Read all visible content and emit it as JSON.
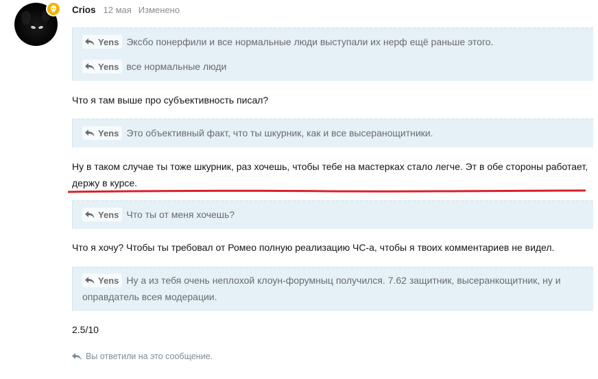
{
  "post": {
    "author": "Crios",
    "date": "12 мая",
    "edited": "Изменено"
  },
  "blocks": [
    {
      "kind": "quote",
      "lines": [
        {
          "name": "Yens",
          "text": "Эксбо понерфили и все нормальные люди выступали их нерф ещё раньше этого."
        },
        {
          "name": "Yens",
          "text": "все нормальные люди"
        }
      ]
    },
    {
      "kind": "text",
      "text": "Что я там выше про субъективность писал?"
    },
    {
      "kind": "quote",
      "lines": [
        {
          "name": "Yens",
          "text": "Это объективный факт, что ты шкурник, как и все высеранощитники."
        }
      ]
    },
    {
      "kind": "text",
      "text": "Ну в таком случае ты тоже шкурник, раз хочешь, чтобы тебе на мастерках стало легче. Эт в обе стороны работает,",
      "text2": "держу в курсе."
    },
    {
      "kind": "quote",
      "lines": [
        {
          "name": "Yens",
          "text": "Что ты от меня хочешь?"
        }
      ]
    },
    {
      "kind": "text",
      "text": "Что я хочу? Чтобы ты требовал от Ромео полную реализацию ЧС-а, чтобы я твоих комментариев не видел."
    },
    {
      "kind": "quote",
      "lines": [
        {
          "name": "Yens",
          "text": "Ну а из тебя очень неплохой клоун-форумныц получился. 7.62 защитник, высеранкощитник, ну и",
          "text2": "оправдатель всея модерации."
        }
      ]
    },
    {
      "kind": "text",
      "text": "2.5/10"
    }
  ],
  "footer": {
    "replied": "Вы ответили на это сообщение."
  },
  "colors": {
    "quote_bg": "#e6f1f7",
    "underline": "#d9202a",
    "badge": "#f2b200"
  }
}
